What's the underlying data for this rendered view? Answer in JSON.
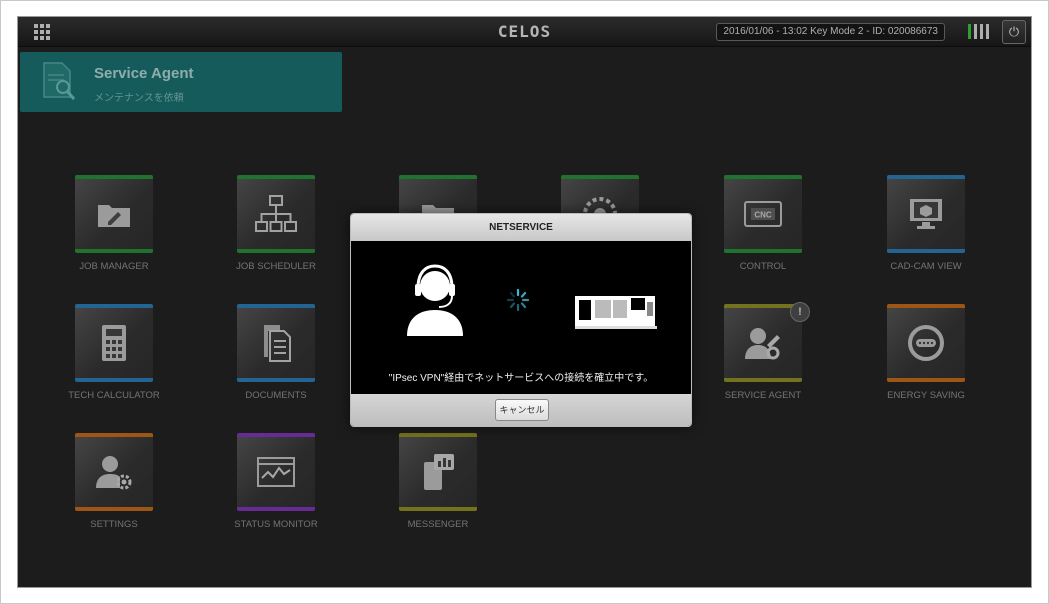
{
  "header": {
    "brand": "CELOS",
    "status": "2016/01/06 - 13:02  Key Mode 2 - ID: 020086673",
    "apps_icon": "grid-icon",
    "power_icon": "power-icon",
    "signal_bars": 4
  },
  "service_agent_tile": {
    "title": "Service Agent",
    "subtitle": "メンテナンスを依頼"
  },
  "apps": [
    {
      "label": "JOB MANAGER",
      "icon": "folder-edit-icon",
      "color": "#2b9a3e"
    },
    {
      "label": "JOB SCHEDULER",
      "icon": "hierarchy-icon",
      "color": "#2b9a3e"
    },
    {
      "label": "",
      "icon": "folder-icon",
      "color": "#2b9a3e"
    },
    {
      "label": "",
      "icon": "saw-blade-icon",
      "color": "#2b9a3e"
    },
    {
      "label": "CONTROL",
      "icon": "cnc-screen-icon",
      "color": "#2b9a3e"
    },
    {
      "label": "CAD-CAM VIEW",
      "icon": "monitor-cube-icon",
      "color": "#2f86c4"
    },
    {
      "label": "TECH CALCULATOR",
      "icon": "calculator-icon",
      "color": "#2f86c4"
    },
    {
      "label": "DOCUMENTS",
      "icon": "documents-icon",
      "color": "#2f86c4"
    },
    {
      "label": "SERVICE AGENT",
      "icon": "service-agent-icon",
      "color": "#9a9a2a",
      "badge": "!"
    },
    {
      "label": "ENERGY SAVING",
      "icon": "energy-gauge-icon",
      "color": "#d2731c"
    },
    {
      "label": "SETTINGS",
      "icon": "user-gear-icon",
      "color": "#d2731c"
    },
    {
      "label": "STATUS MONITOR",
      "icon": "status-monitor-icon",
      "color": "#8a3ac6"
    },
    {
      "label": "MESSENGER",
      "icon": "messenger-icon",
      "color": "#9a9a2a"
    }
  ],
  "dialog": {
    "title": "NETSERVICE",
    "message": "\"IPsec VPN\"経由でネットサービスへの接続を確立中です。",
    "cancel_label": "キャンセル",
    "icons": [
      "headset-person-icon",
      "loading-spinner-icon",
      "machine-icon"
    ]
  }
}
